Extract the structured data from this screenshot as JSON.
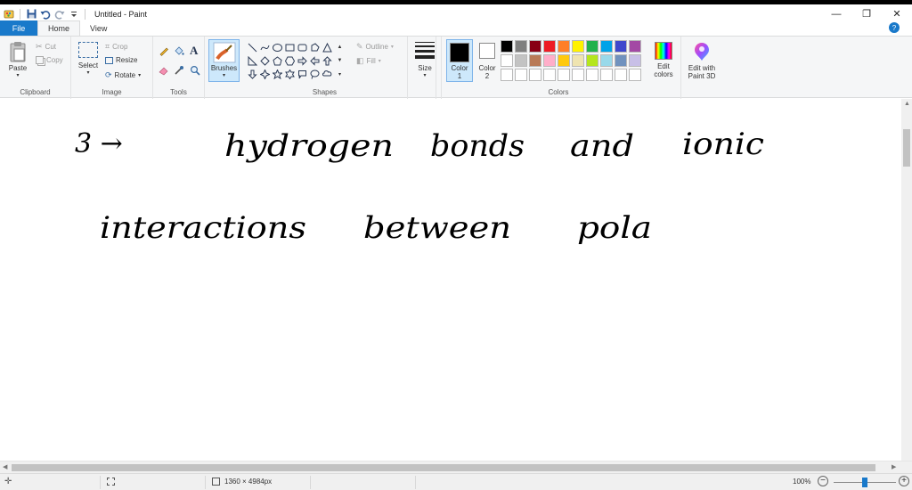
{
  "window": {
    "title": "Untitled - Paint",
    "minimize": "—",
    "maximize": "❐",
    "close": "✕"
  },
  "tabs": {
    "file": "File",
    "home": "Home",
    "view": "View"
  },
  "help": "?",
  "clipboard": {
    "paste": "Paste",
    "cut": "Cut",
    "copy": "Copy",
    "group": "Clipboard"
  },
  "image": {
    "select": "Select",
    "crop": "Crop",
    "resize": "Resize",
    "rotate": "Rotate",
    "group": "Image"
  },
  "tools": {
    "group": "Tools",
    "brushes": "Brushes"
  },
  "shapes": {
    "group": "Shapes",
    "outline": "Outline",
    "fill": "Fill"
  },
  "size": {
    "label": "Size"
  },
  "colors": {
    "color1_line1": "Color",
    "color1_line2": "1",
    "color2_line1": "Color",
    "color2_line2": "2",
    "edit_line1": "Edit",
    "edit_line2": "colors",
    "paint3d_line1": "Edit with",
    "paint3d_line2": "Paint 3D",
    "group": "Colors",
    "color1_value": "#000000",
    "color2_value": "#ffffff",
    "palette": [
      "#000000",
      "#7f7f7f",
      "#880015",
      "#ed1c24",
      "#ff7f27",
      "#fff200",
      "#22b14c",
      "#00a2e8",
      "#3f48cc",
      "#a349a4",
      "#ffffff",
      "#c3c3c3",
      "#b97a57",
      "#ffaec9",
      "#ffc90e",
      "#efe4b0",
      "#b5e61d",
      "#99d9ea",
      "#7092be",
      "#c8bfe7",
      "#ffffff",
      "#ffffff",
      "#ffffff",
      "#ffffff",
      "#ffffff",
      "#ffffff",
      "#ffffff",
      "#ffffff",
      "#ffffff",
      "#ffffff"
    ]
  },
  "handwriting": {
    "line1": [
      "3 →",
      "hydrogen",
      "bonds",
      "and",
      "ionic"
    ],
    "line2": [
      "interactions",
      "between",
      "pola"
    ]
  },
  "status": {
    "dimensions": "1360 × 4984px",
    "zoom": "100%",
    "zoom_level_percent": 100
  }
}
